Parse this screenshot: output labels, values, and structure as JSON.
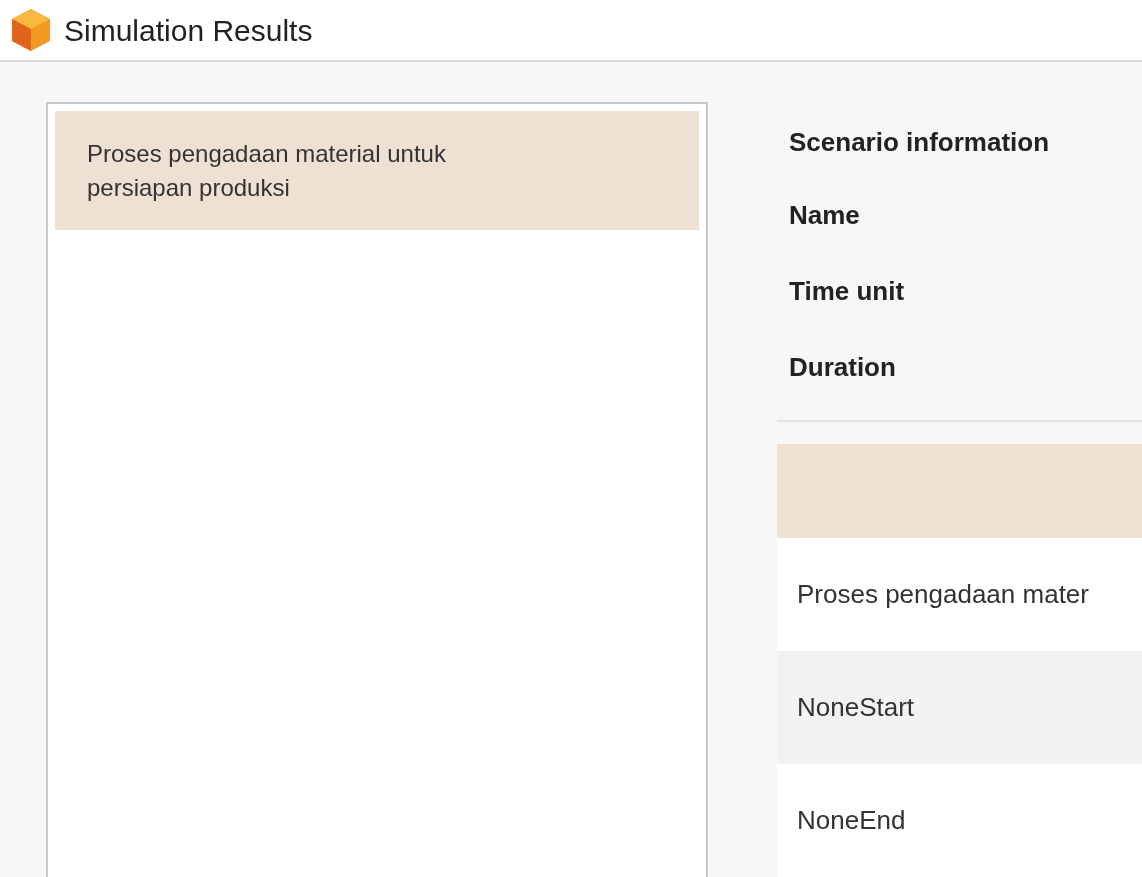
{
  "window": {
    "title": "Simulation Results"
  },
  "scenarios": [
    {
      "label": "Proses pengadaan material untuk persiapan produksi",
      "selected": true
    }
  ],
  "scenario_info": {
    "heading": "Scenario information",
    "fields": [
      {
        "label": "Name"
      },
      {
        "label": "Time unit"
      },
      {
        "label": "Duration"
      }
    ]
  },
  "table": {
    "rows": [
      {
        "cells": [
          "Proses pengadaan mater"
        ]
      },
      {
        "cells": [
          "NoneStart"
        ]
      },
      {
        "cells": [
          "NoneEnd"
        ]
      }
    ]
  }
}
